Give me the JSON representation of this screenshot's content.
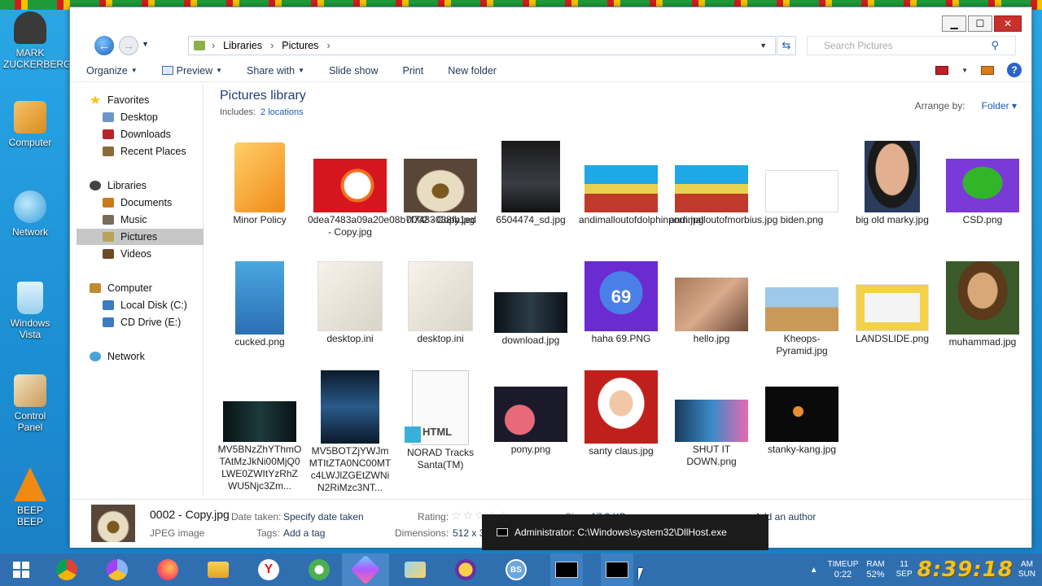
{
  "desktop": {
    "icons": [
      {
        "label": "MARK ZUCKERBERG",
        "icon": "person-icon"
      },
      {
        "label": "Computer",
        "icon": "computer-icon"
      },
      {
        "label": "Network",
        "icon": "network-globe-icon"
      },
      {
        "label": "Windows Vista",
        "icon": "recycle-bin-icon"
      },
      {
        "label": "Control Panel",
        "icon": "control-panel-icon"
      },
      {
        "label": "BEEP BEEP",
        "icon": "vlc-cone-icon"
      }
    ]
  },
  "window": {
    "buttons": {
      "minimize": "▁",
      "maximize": "☐",
      "close": "✕"
    },
    "address": {
      "crumbs": [
        "Libraries",
        "Pictures"
      ],
      "search_placeholder": "Search Pictures"
    },
    "toolbar": {
      "organize": "Organize",
      "preview": "Preview",
      "share_with": "Share with",
      "slide_show": "Slide show",
      "print": "Print",
      "new_folder": "New folder"
    },
    "sidebar": {
      "favorites": "Favorites",
      "desktop": "Desktop",
      "downloads": "Downloads",
      "recent": "Recent Places",
      "libraries": "Libraries",
      "documents": "Documents",
      "music": "Music",
      "pictures": "Pictures",
      "videos": "Videos",
      "computer": "Computer",
      "local_disk": "Local Disk (C:)",
      "cd_drive": "CD Drive (E:)",
      "network": "Network"
    },
    "content": {
      "title": "Pictures library",
      "includes_label": "Includes:",
      "includes_link": "2 locations",
      "arrange_label": "Arrange by:",
      "arrange_value": "Folder"
    },
    "files": [
      "Minor Policy",
      "0dea7483a09a20e08b7f7483088fb1ed - Copy.jpg",
      "0002 - Copy.jpg",
      "6504474_sd.jpg",
      "andimalloutofdolphinporn.jpg",
      "andimalloutofmorbius.jpg",
      "biden.png",
      "big old marky.jpg",
      "CSD.png",
      "cucked.png",
      "desktop.ini",
      "desktop.ini",
      "download.jpg",
      "haha 69.PNG",
      "hello.jpg",
      "Kheops-Pyramid.jpg",
      "LANDSLIDE.png",
      "muhammad.jpg",
      "MV5BNzZhYThmOTAtMzJkNi00MjQ0LWE0ZWItYzRhZWU5Njc3Zm...",
      "MV5BOTZjYWJmMTItZTA0NC00MTc4LWJlZGEtZWNiN2RiMzc3NT...",
      "NORAD Tracks Santa(TM)",
      "pony.png",
      "santy claus.jpg",
      "SHUT IT DOWN.png",
      "stanky-kang.jpg"
    ],
    "thumb_html_label": "HTML",
    "thumb_69_label": "69",
    "details": {
      "name": "0002 - Copy.jpg",
      "type": "JPEG image",
      "date_label": "Date taken:",
      "date_value": "Specify date taken",
      "tags_label": "Tags:",
      "tags_value": "Add a tag",
      "rating_label": "Rating:",
      "size_label": "Size:",
      "size_value": "17.3 KB",
      "dimensions_label": "Dimensions:",
      "dimensions_value": "512 x 3",
      "author_value": "Add an author"
    }
  },
  "toast": {
    "text": "Administrator: C:\\Windows\\system32\\DllHost.exe"
  },
  "taskbar": {
    "apps": [
      "start-icon",
      "chrome-icon",
      "chromium-icon",
      "firefox-icon",
      "explorer-icon",
      "yandex-icon",
      "app-icon",
      "prism-icon",
      "folder-icon",
      "yahoo-icon",
      "bs-icon",
      "cmd-icon",
      "cmd-icon"
    ],
    "bs_label": "BS",
    "tray": {
      "timeup_label": "TIMEUP",
      "timeup_value": "0:22",
      "ram_label": "RAM",
      "ram_value": "52%",
      "day": "11",
      "month": "SEP",
      "clock": "8:39:18",
      "ampm": "AM",
      "weekday": "SUN"
    }
  },
  "colors": {
    "accent": "#1c5fb4",
    "taskbar": "#2f6fb0",
    "clock": "#f4c21f",
    "close": "#c9302c"
  }
}
